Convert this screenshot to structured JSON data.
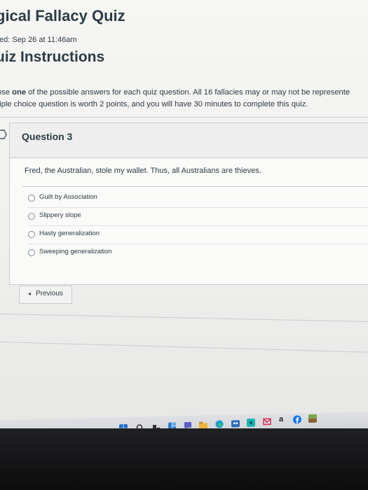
{
  "page": {
    "quiz_title": "gical Fallacy Quiz",
    "started": "ted: Sep 26 at 11:46am",
    "instructions_heading": "uiz Instructions",
    "instructions_line1_pre": "ose ",
    "instructions_line1_bold": "one",
    "instructions_line1_post": " of the possible answers for each quiz question. All 16 fallacies may or may not be represente",
    "instructions_line2": "tiple choice question is worth 2 points, and you will have 30 minutes to complete this quiz."
  },
  "question": {
    "label": "Question 3",
    "text": "Fred, the Australian, stole my wallet. Thus, all Australians are thieves.",
    "answers": [
      {
        "label": "Guilt by Association"
      },
      {
        "label": "Slippery slope"
      },
      {
        "label": "Hasty generalization"
      },
      {
        "label": "Sweeping generalization"
      }
    ]
  },
  "navigation": {
    "previous_arrow": "◂",
    "previous_label": "Previous"
  },
  "taskbar": {
    "icons": [
      {
        "name": "windows-start-icon",
        "color": "#1e6fd0"
      },
      {
        "name": "search-icon",
        "color": "#333333"
      },
      {
        "name": "task-view-icon",
        "color": "#333333"
      },
      {
        "name": "widgets-icon",
        "color": "#2f7fd8"
      },
      {
        "name": "chat-icon",
        "color": "#5b5fc7"
      },
      {
        "name": "file-explorer-icon",
        "color": "#e9b53b"
      },
      {
        "name": "edge-icon",
        "color": "#1a9fd8"
      },
      {
        "name": "store-icon",
        "color": "#2f6fb5"
      },
      {
        "name": "app-icon",
        "color": "#1db4b4"
      },
      {
        "name": "mail-icon",
        "color": "#d8365c"
      },
      {
        "name": "amazon-icon",
        "color": "#222222"
      },
      {
        "name": "facebook-icon",
        "color": "#1877f2"
      },
      {
        "name": "minecraft-icon",
        "color": "#7aa84b"
      }
    ],
    "amazon_letter": "a"
  }
}
